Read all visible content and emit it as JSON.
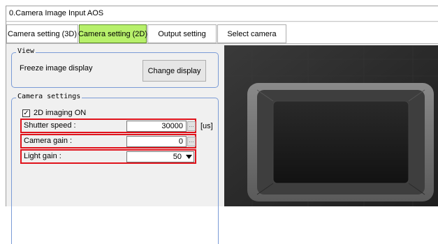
{
  "window": {
    "title": "0.Camera Image Input AOS"
  },
  "tabs": [
    {
      "label": "Camera setting (3D)",
      "active": false
    },
    {
      "label": "Camera setting (2D)",
      "active": true
    },
    {
      "label": "Output setting",
      "active": false
    },
    {
      "label": "Select camera",
      "active": false
    }
  ],
  "view": {
    "legend": "View",
    "freeze_label": "Freeze image display",
    "change_display_button": "Change display"
  },
  "camera_settings": {
    "legend": "Camera settings",
    "imaging_2d": {
      "label": "2D imaging ON",
      "checked": true
    },
    "shutter_speed": {
      "label": "Shutter speed :",
      "value": "30000",
      "unit": "[us]"
    },
    "camera_gain": {
      "label": "Camera gain :",
      "value": "0"
    },
    "light_gain": {
      "label": "Light gain :",
      "value": "50"
    }
  },
  "colors": {
    "active_tab": "#b7f06b",
    "highlight_border": "#e0121b",
    "group_border": "#7a9bd6"
  },
  "icons": {
    "checkmark": "check-icon",
    "dropdown": "chevron-down-icon",
    "ellipsis": "ellipsis-icon"
  }
}
